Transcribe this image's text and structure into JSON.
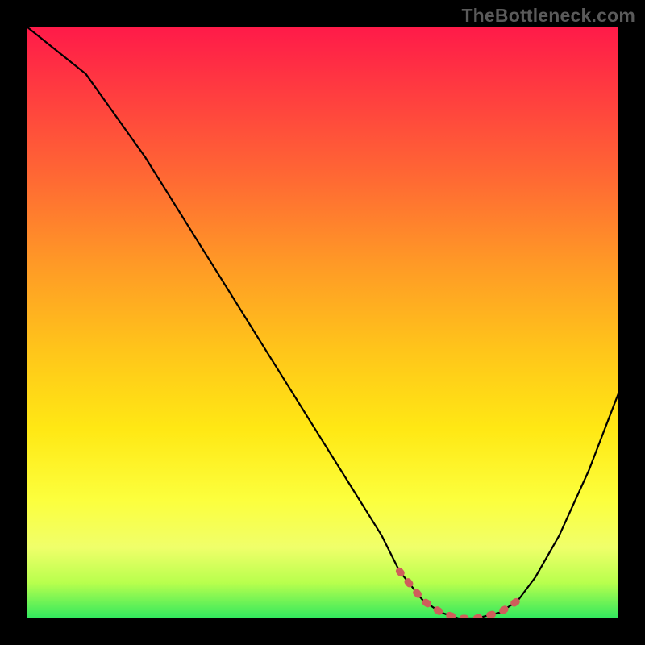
{
  "watermark": "TheBottleneck.com",
  "colors": {
    "frame_bg": "#000000",
    "highlight_stroke": "#cf5e5b",
    "curve_stroke": "#000000",
    "gradient_top": "#ff1a49",
    "gradient_bottom": "#30e85e"
  },
  "chart_data": {
    "type": "line",
    "title": "",
    "xlabel": "",
    "ylabel": "",
    "xlim": [
      0,
      100
    ],
    "ylim": [
      0,
      100
    ],
    "grid": false,
    "series": [
      {
        "name": "bottleneck-curve",
        "x": [
          0,
          5,
          10,
          15,
          20,
          25,
          30,
          35,
          40,
          45,
          50,
          55,
          60,
          63,
          67,
          70,
          73,
          76,
          80,
          83,
          86,
          90,
          95,
          100
        ],
        "values": [
          100,
          96,
          92,
          85,
          78,
          70,
          62,
          54,
          46,
          38,
          30,
          22,
          14,
          8,
          3,
          1,
          0,
          0,
          1,
          3,
          7,
          14,
          25,
          38
        ]
      }
    ],
    "annotations": [
      {
        "name": "optimal-range",
        "type": "range",
        "x_start": 63,
        "x_end": 83,
        "note": "dotted highlight along trough"
      }
    ]
  }
}
